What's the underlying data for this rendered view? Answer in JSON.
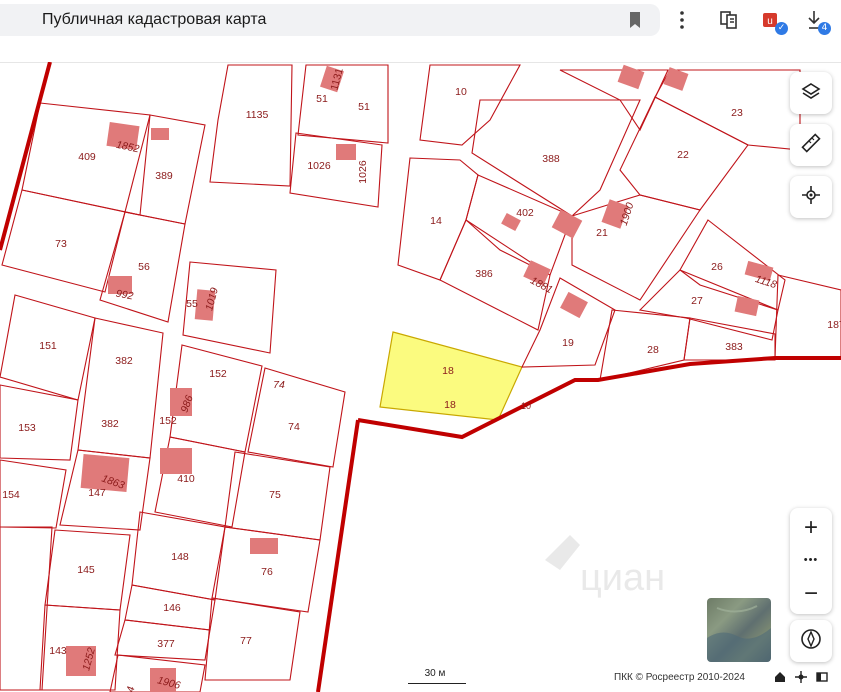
{
  "browser": {
    "page_title": "Публичная кадастровая карта",
    "downloads_badge": "4",
    "colors": {
      "address_bg": "#f1f2f4",
      "badge": "#2f7ae5"
    },
    "icons": [
      "bookmark-icon",
      "menu-dots-icon",
      "collections-icon",
      "extension-icon",
      "downloads-icon"
    ]
  },
  "map": {
    "parcel_labels": {
      "p10": "10",
      "p1135": "1135",
      "p51a": "51",
      "p51b": "51",
      "p1131": "1131",
      "p409": "409",
      "p1852": "1852",
      "p389": "389",
      "p1026a": "1026",
      "p1026b": "1026",
      "p388": "388",
      "p22": "22",
      "p23": "23",
      "p14": "14",
      "p402": "402",
      "p21": "21",
      "p1900": "1900",
      "p73": "73",
      "p56": "56",
      "p992": "992",
      "p55": "55",
      "p1019": "1019",
      "p386": "386",
      "p1881": "1881",
      "p26": "26",
      "p1118": "1118",
      "p27": "27",
      "p151": "151",
      "p382a": "382",
      "p19": "19",
      "p28": "28",
      "p383": "383",
      "p187": "187",
      "p152a": "152",
      "p74a": "74",
      "p18a": "18",
      "p18b": "18",
      "p153": "153",
      "p382b": "382",
      "p986": "986",
      "p152b": "152",
      "p74b": "74",
      "p410": "410",
      "p154": "154",
      "p147": "147",
      "p1863": "1863",
      "p75": "75",
      "p148": "148",
      "p76": "76",
      "p145": "145",
      "p146": "146",
      "p377": "377",
      "p77": "77",
      "p143": "143",
      "p1252": "1252",
      "p1906": "1906",
      "p4": "4",
      "p10b": "10"
    },
    "selected_parcel": "18",
    "watermark": "циан",
    "scale_label": "30 м",
    "copyright": "ПКК © Росреестр 2010-2024",
    "colors": {
      "parcel_line": "#c0141a",
      "boundary": "#c00000",
      "building": "#e07a7a",
      "selected_fill": "#fbfb7f",
      "label": "#8b1a1a"
    },
    "controls": {
      "layers_icon": "layers-icon",
      "ruler_icon": "ruler-icon",
      "locate_icon": "crosshair-icon",
      "zoom_in": "+",
      "zoom_more": "•••",
      "zoom_out": "−",
      "compass_icon": "compass-icon"
    }
  }
}
